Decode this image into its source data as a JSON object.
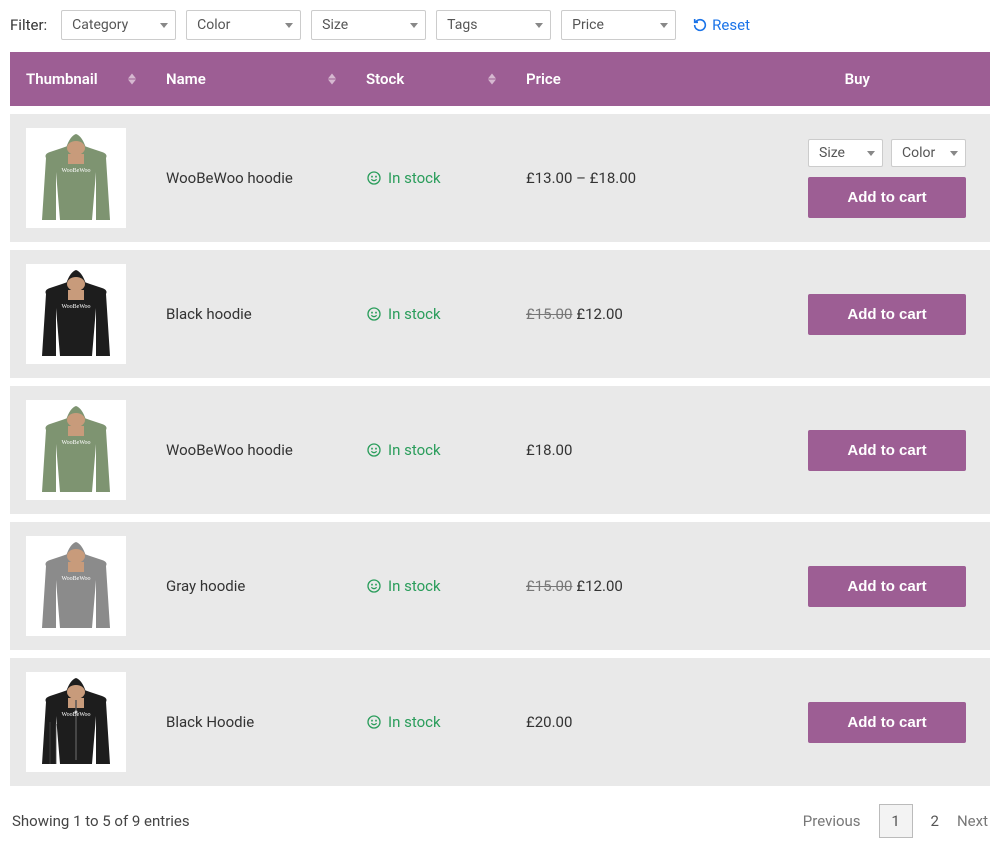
{
  "filter": {
    "label": "Filter:",
    "dropdowns": [
      "Category",
      "Color",
      "Size",
      "Tags",
      "Price"
    ],
    "reset": "Reset"
  },
  "columns": {
    "thumbnail": "Thumbnail",
    "name": "Name",
    "stock": "Stock",
    "price": "Price",
    "buy": "Buy"
  },
  "stock_label": "In stock",
  "add_label": "Add to cart",
  "variant": {
    "size": "Size",
    "color": "Color"
  },
  "rows": [
    {
      "name": "WooBeWoo hoodie",
      "price_html": "£13.00 – £18.00",
      "has_variants": true,
      "color": "green",
      "zip": false
    },
    {
      "name": "Black hoodie",
      "strike": "£15.00",
      "price_html": "£12.00",
      "has_variants": false,
      "color": "black",
      "zip": false
    },
    {
      "name": "WooBeWoo hoodie",
      "price_html": "£18.00",
      "has_variants": false,
      "color": "green",
      "zip": false
    },
    {
      "name": "Gray hoodie",
      "strike": "£15.00",
      "price_html": "£12.00",
      "has_variants": false,
      "color": "gray",
      "zip": false
    },
    {
      "name": "Black Hoodie",
      "price_html": "£20.00",
      "has_variants": false,
      "color": "black",
      "zip": true
    }
  ],
  "footer": {
    "info": "Showing 1 to 5 of 9 entries",
    "prev": "Previous",
    "pages": [
      "1",
      "2"
    ],
    "current": "1",
    "next": "Next"
  }
}
